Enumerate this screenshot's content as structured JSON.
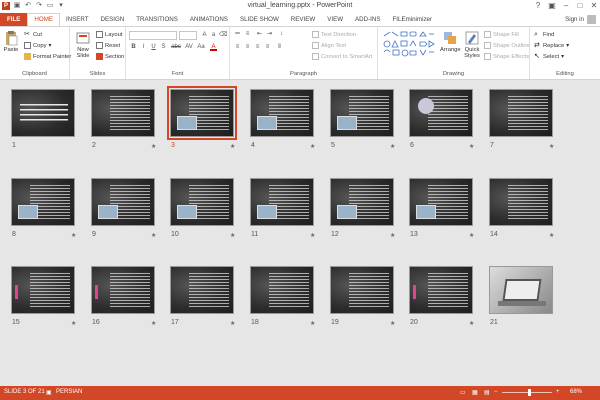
{
  "window": {
    "title": "virtual_learning.pptx - PowerPoint"
  },
  "tabs": [
    "FILE",
    "HOME",
    "INSERT",
    "DESIGN",
    "TRANSITIONS",
    "ANIMATIONS",
    "SLIDE SHOW",
    "REVIEW",
    "VIEW",
    "ADD-INS",
    "FILEminimizer"
  ],
  "account": {
    "signin": "Sign in"
  },
  "ribbon": {
    "clipboard": {
      "label": "Clipboard",
      "paste": "Paste",
      "cut": "Cut",
      "copy": "Copy",
      "format_painter": "Format Painter"
    },
    "slides": {
      "label": "Slides",
      "new_slide": "New Slide",
      "layout": "Layout",
      "reset": "Reset",
      "section": "Section"
    },
    "font": {
      "label": "Font",
      "bold": "B",
      "italic": "I",
      "underline": "U",
      "shadow": "S",
      "strike": "abc",
      "char_spacing": "AV",
      "case": "Aa",
      "color": "A"
    },
    "paragraph": {
      "label": "Paragraph",
      "text_direction": "Text Direction",
      "align_text": "Align Text",
      "smartart": "Convert to SmartArt"
    },
    "drawing": {
      "label": "Drawing",
      "arrange": "Arrange",
      "quick_styles": "Quick Styles",
      "shape_fill": "Shape Fill",
      "shape_outline": "Shape Outline",
      "shape_effects": "Shape Effects"
    },
    "editing": {
      "label": "Editing",
      "find": "Find",
      "replace": "Replace",
      "select": "Select"
    }
  },
  "slides": [
    {
      "num": "1",
      "kind": "title",
      "star": false
    },
    {
      "num": "2",
      "kind": "text",
      "star": true
    },
    {
      "num": "3",
      "kind": "text-pic",
      "star": true,
      "selected": true
    },
    {
      "num": "4",
      "kind": "text-pic",
      "star": true
    },
    {
      "num": "5",
      "kind": "text-pic",
      "star": true
    },
    {
      "num": "6",
      "kind": "circle",
      "star": true
    },
    {
      "num": "7",
      "kind": "text",
      "star": true
    },
    {
      "num": "8",
      "kind": "text-pic",
      "star": true
    },
    {
      "num": "9",
      "kind": "text-pic",
      "star": true
    },
    {
      "num": "10",
      "kind": "text-pic",
      "star": true
    },
    {
      "num": "11",
      "kind": "text-pic",
      "star": true
    },
    {
      "num": "12",
      "kind": "text-pic",
      "star": true
    },
    {
      "num": "13",
      "kind": "text-pic",
      "star": true
    },
    {
      "num": "14",
      "kind": "text",
      "star": true
    },
    {
      "num": "15",
      "kind": "text-pink",
      "star": true
    },
    {
      "num": "16",
      "kind": "text-pink",
      "star": true
    },
    {
      "num": "17",
      "kind": "text",
      "star": true
    },
    {
      "num": "18",
      "kind": "text",
      "star": true
    },
    {
      "num": "19",
      "kind": "text",
      "star": true
    },
    {
      "num": "20",
      "kind": "text-pink",
      "star": true
    },
    {
      "num": "21",
      "kind": "laptop",
      "star": false
    }
  ],
  "status": {
    "slide": "SLIDE 3 OF 21",
    "language": "PERSIAN",
    "zoom": "68%"
  },
  "colors": {
    "accent": "#d24726",
    "selection": "#d24726"
  }
}
